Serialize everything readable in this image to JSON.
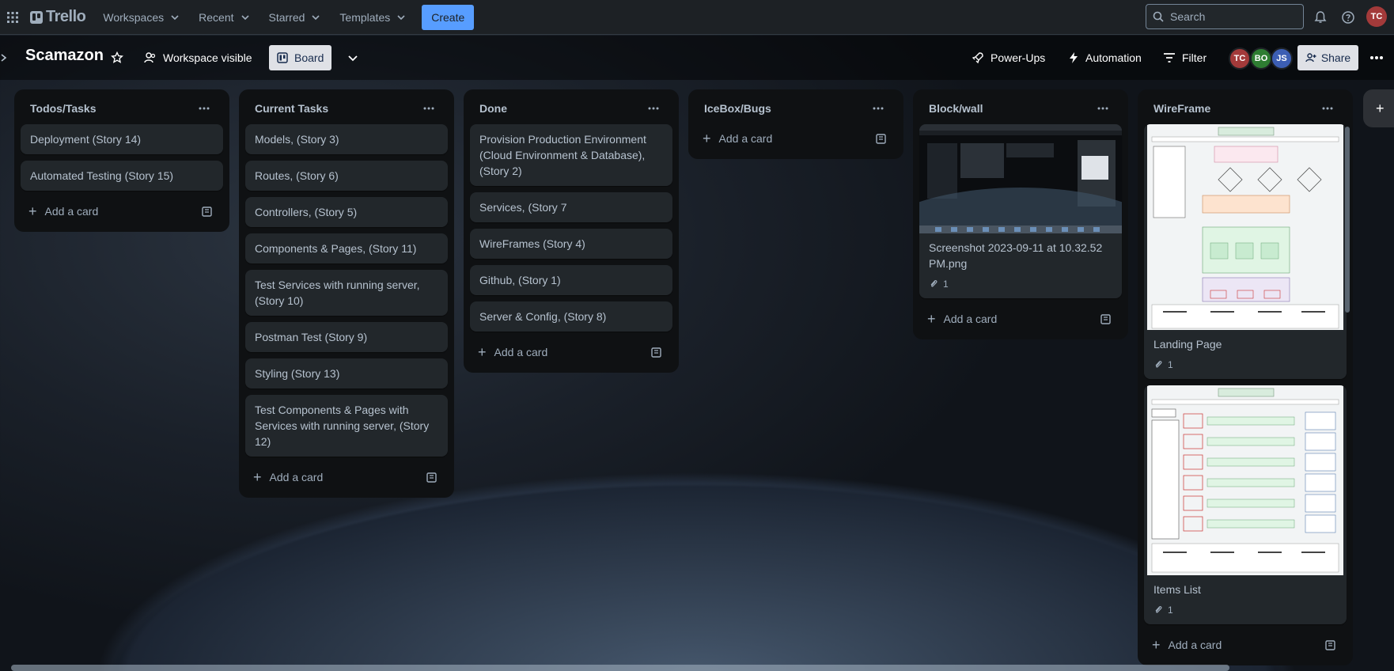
{
  "header": {
    "logo": "Trello",
    "nav": [
      {
        "label": "Workspaces"
      },
      {
        "label": "Recent"
      },
      {
        "label": "Starred"
      },
      {
        "label": "Templates"
      }
    ],
    "create_label": "Create",
    "search_placeholder": "Search",
    "user_initials": "TC"
  },
  "board": {
    "title": "Scamazon",
    "visibility_label": "Workspace visible",
    "view_label": "Board",
    "powerups_label": "Power-Ups",
    "automation_label": "Automation",
    "filter_label": "Filter",
    "share_label": "Share",
    "members": [
      {
        "initials": "TC",
        "color": "#a33a3a"
      },
      {
        "initials": "BO",
        "color": "#2e7d32"
      },
      {
        "initials": "JS",
        "color": "#3c5eb3"
      }
    ]
  },
  "add_card_label": "Add a card",
  "lists": [
    {
      "title": "Todos/Tasks",
      "cards": [
        {
          "text": "Deployment (Story 14)"
        },
        {
          "text": "Automated Testing (Story 15)"
        }
      ]
    },
    {
      "title": "Current Tasks",
      "cards": [
        {
          "text": "Models, (Story 3)"
        },
        {
          "text": "Routes, (Story 6)"
        },
        {
          "text": "Controllers, (Story 5)"
        },
        {
          "text": "Components & Pages, (Story 11)"
        },
        {
          "text": "Test Services with running server, (Story 10)"
        },
        {
          "text": "Postman Test (Story 9)"
        },
        {
          "text": "Styling (Story 13)"
        },
        {
          "text": "Test Components & Pages with Services with running server, (Story 12)"
        }
      ]
    },
    {
      "title": "Done",
      "cards": [
        {
          "text": "Provision Production Environment (Cloud Environment & Database), (Story 2)"
        },
        {
          "text": "Services, (Story 7"
        },
        {
          "text": "WireFrames (Story 4)"
        },
        {
          "text": "Github, (Story 1)"
        },
        {
          "text": "Server & Config, (Story 8)"
        }
      ]
    },
    {
      "title": "IceBox/Bugs",
      "cards": []
    },
    {
      "title": "Block/wall",
      "cards": [
        {
          "text": "Screenshot 2023-09-11 at 10.32.52 PM.png",
          "attachments": "1"
        }
      ]
    },
    {
      "title": "WireFrame",
      "cards": [
        {
          "text": "Landing Page",
          "attachments": "1"
        },
        {
          "text": "Items List",
          "attachments": "1"
        }
      ]
    }
  ],
  "colors": {
    "header_bg": "#1d2125",
    "list_bg": "#0f1113",
    "card_bg": "#22272b",
    "accent": "#579dff"
  }
}
